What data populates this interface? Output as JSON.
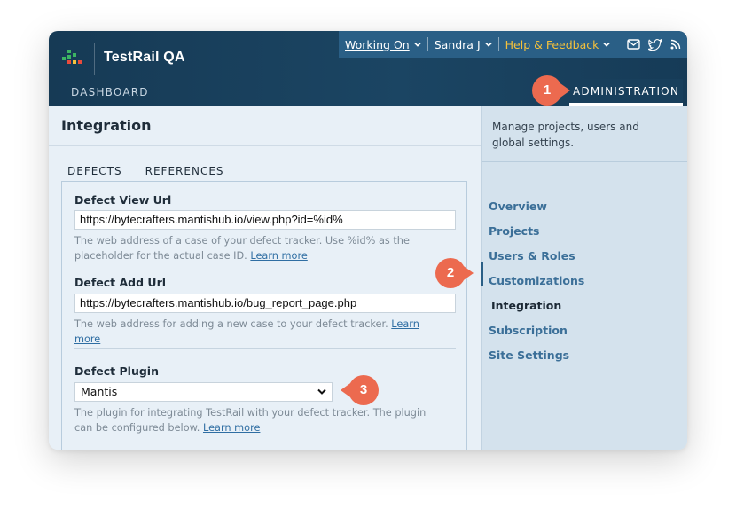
{
  "colors": {
    "header_bg": "#1b4563",
    "user_menu_bg": "#2a5f86",
    "help_yellow": "#f4c13c",
    "link_blue": "#2f6ea3",
    "sidebar_link": "#3b6f98",
    "callout_orange": "#ec6a4f"
  },
  "header": {
    "app_title": "TestRail QA",
    "user_menu": {
      "working_on": "Working On",
      "user": "Sandra J",
      "help": "Help & Feedback",
      "icons": [
        "mail-icon",
        "twitter-icon",
        "rss-icon"
      ]
    },
    "nav": {
      "dashboard": "DASHBOARD",
      "administration": "ADMINISTRATION"
    }
  },
  "main": {
    "title": "Integration",
    "tabs": [
      {
        "label": "DEFECTS",
        "active": true
      },
      {
        "label": "REFERENCES",
        "active": false
      }
    ],
    "defect_view_url": {
      "label": "Defect View Url",
      "value": "https://bytecrafters.mantishub.io/view.php?id=%id%",
      "help": "The web address of a case of your defect tracker. Use %id% as the placeholder for the actual case ID.",
      "help_link": "Learn more"
    },
    "defect_add_url": {
      "label": "Defect Add Url",
      "value": "https://bytecrafters.mantishub.io/bug_report_page.php",
      "help": "The web address for adding a new case to your defect tracker.",
      "help_link": "Learn more"
    },
    "defect_plugin": {
      "label": "Defect Plugin",
      "value": "Mantis",
      "help": "The plugin for integrating TestRail with your defect tracker. The plugin can be configured below.",
      "help_link": "Learn more"
    }
  },
  "sidebar": {
    "description": "Manage projects, users and global settings.",
    "items": [
      {
        "label": "Overview",
        "active": false
      },
      {
        "label": "Projects",
        "active": false
      },
      {
        "label": "Users & Roles",
        "active": false
      },
      {
        "label": "Customizations",
        "active": false
      },
      {
        "label": "Integration",
        "active": true
      },
      {
        "label": "Subscription",
        "active": false
      },
      {
        "label": "Site Settings",
        "active": false
      }
    ]
  },
  "callouts": [
    "1",
    "2",
    "3"
  ]
}
